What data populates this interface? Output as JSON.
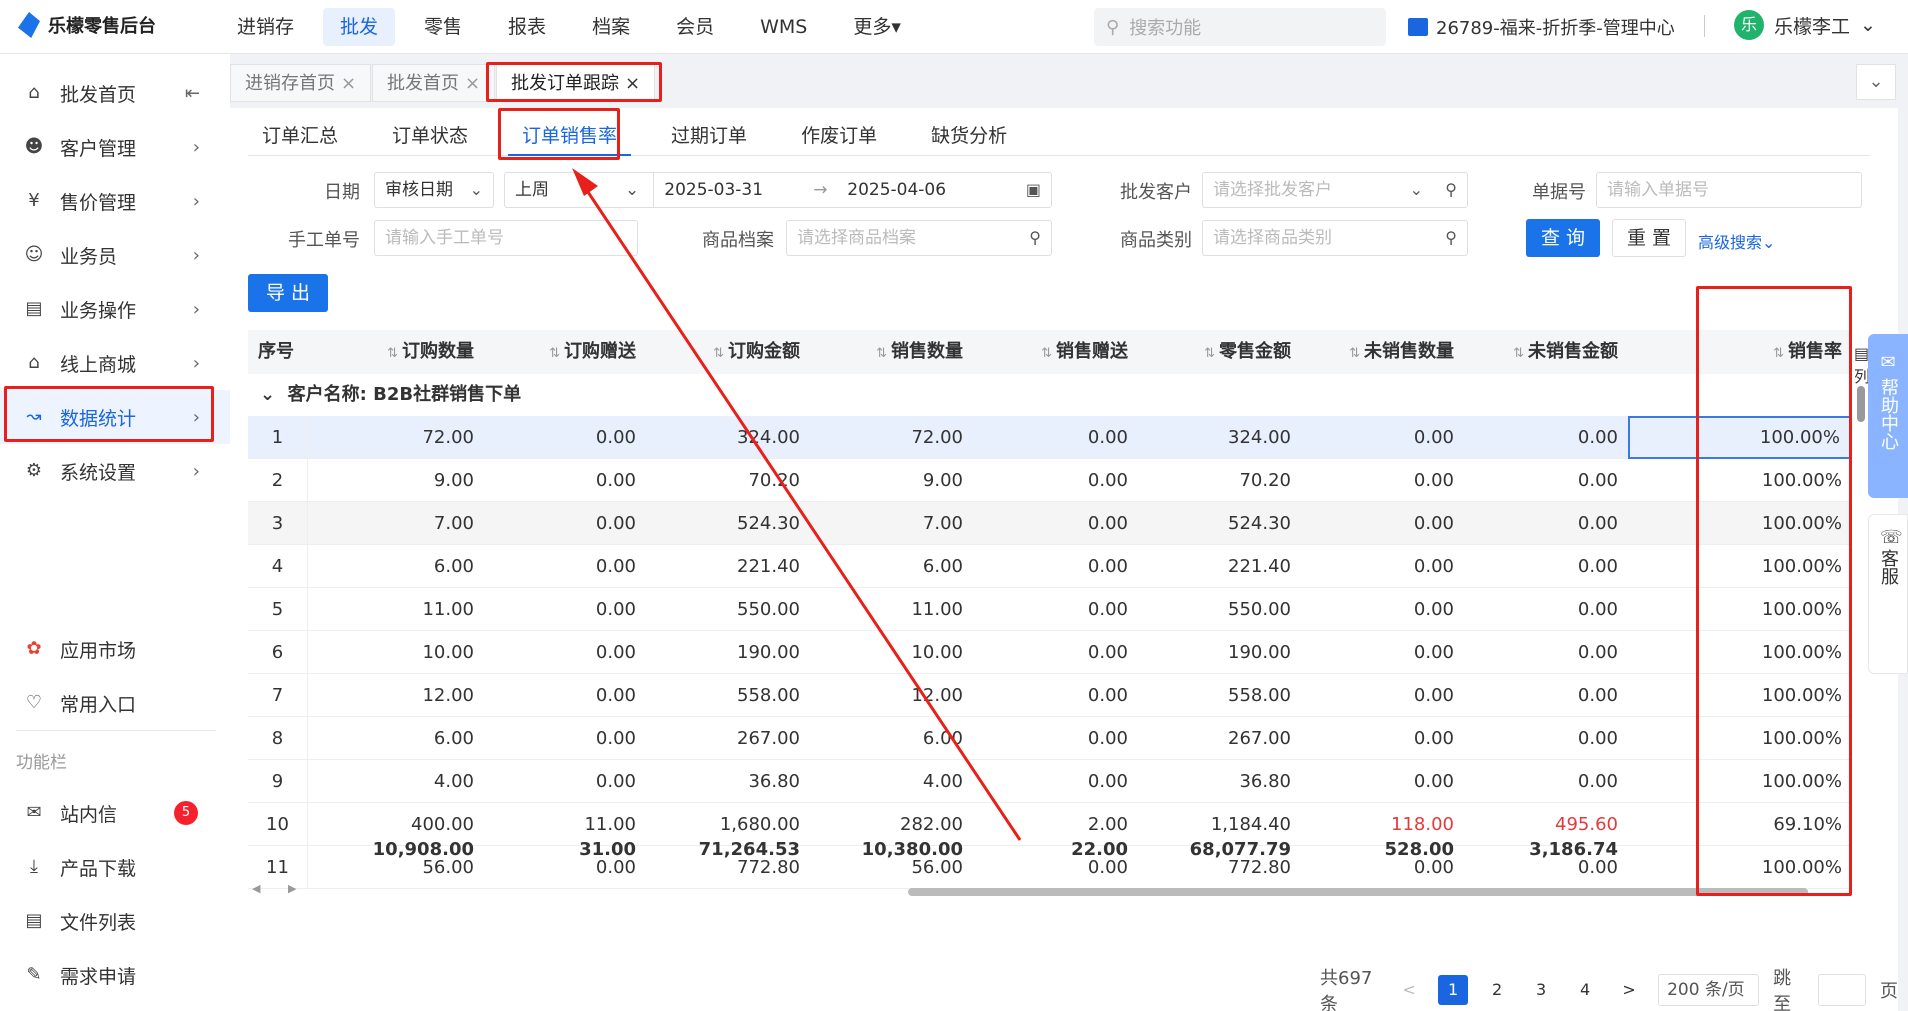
{
  "header": {
    "logo_text": "乐檬零售后台",
    "nav": [
      "进销存",
      "批发",
      "零售",
      "报表",
      "档案",
      "会员",
      "WMS",
      "更多▾"
    ],
    "active_nav": "批发",
    "search_placeholder": "搜索功能",
    "store": "26789-福来-折折季-管理中心",
    "avatar_char": "乐",
    "user_name": "乐檬李工"
  },
  "sidebar": {
    "items": [
      {
        "label": "批发首页",
        "icon": "home-icon",
        "chev": "⇤"
      },
      {
        "label": "客户管理",
        "icon": "user-icon",
        "chev": "›"
      },
      {
        "label": "售价管理",
        "icon": "yen-icon",
        "chev": "›"
      },
      {
        "label": "业务员",
        "icon": "person-icon",
        "chev": "›"
      },
      {
        "label": "业务操作",
        "icon": "panel-icon",
        "chev": "›"
      },
      {
        "label": "线上商城",
        "icon": "shop-icon",
        "chev": "›"
      },
      {
        "label": "数据统计",
        "icon": "chart-icon",
        "chev": "›"
      },
      {
        "label": "系统设置",
        "icon": "gear-icon",
        "chev": "›"
      }
    ],
    "bottom": [
      {
        "label": "应用市场",
        "icon": "app-market-icon"
      },
      {
        "label": "常用入口",
        "icon": "heart-icon"
      }
    ],
    "section_title": "功能栏",
    "tools": [
      {
        "label": "站内信",
        "icon": "mail-icon"
      },
      {
        "label": "产品下载",
        "icon": "download-icon"
      },
      {
        "label": "文件列表",
        "icon": "file-list-icon"
      },
      {
        "label": "需求申请",
        "icon": "request-icon"
      }
    ],
    "mail_badge": "5"
  },
  "page_tabs": [
    {
      "label": "进销存首页",
      "close": "×"
    },
    {
      "label": "批发首页",
      "close": "×"
    },
    {
      "label": "批发订单跟踪",
      "close": "×"
    }
  ],
  "sub_tabs": [
    "订单汇总",
    "订单状态",
    "订单销售率",
    "过期订单",
    "作废订单",
    "缺货分析"
  ],
  "filters": {
    "date_label": "日期",
    "date_type": "审核日期",
    "date_range": "上周",
    "date_start": "2025-03-31",
    "date_sep": "→",
    "date_end": "2025-04-06",
    "customer_label": "批发客户",
    "customer_placeholder": "请选择批发客户",
    "doc_label": "单据号",
    "doc_placeholder": "请输入单据号",
    "manual_label": "手工单号",
    "manual_placeholder": "请输入手工单号",
    "product_label": "商品档案",
    "product_placeholder": "请选择商品档案",
    "category_label": "商品类别",
    "category_placeholder": "请选择商品类别",
    "query_btn": "查 询",
    "reset_btn": "重 置",
    "advanced": "高级搜索",
    "export_btn": "导 出"
  },
  "table": {
    "columns": [
      "序号",
      "订购数量",
      "订购赠送",
      "订购金额",
      "销售数量",
      "销售赠送",
      "零售金额",
      "未销售数量",
      "未销售金额",
      "销售率"
    ],
    "group_label": "客户名称:  B2B社群销售下单",
    "rows": [
      [
        "1",
        "72.00",
        "0.00",
        "324.00",
        "72.00",
        "0.00",
        "324.00",
        "0.00",
        "0.00",
        "100.00%"
      ],
      [
        "2",
        "9.00",
        "0.00",
        "70.20",
        "9.00",
        "0.00",
        "70.20",
        "0.00",
        "0.00",
        "100.00%"
      ],
      [
        "3",
        "7.00",
        "0.00",
        "524.30",
        "7.00",
        "0.00",
        "524.30",
        "0.00",
        "0.00",
        "100.00%"
      ],
      [
        "4",
        "6.00",
        "0.00",
        "221.40",
        "6.00",
        "0.00",
        "221.40",
        "0.00",
        "0.00",
        "100.00%"
      ],
      [
        "5",
        "11.00",
        "0.00",
        "550.00",
        "11.00",
        "0.00",
        "550.00",
        "0.00",
        "0.00",
        "100.00%"
      ],
      [
        "6",
        "10.00",
        "0.00",
        "190.00",
        "10.00",
        "0.00",
        "190.00",
        "0.00",
        "0.00",
        "100.00%"
      ],
      [
        "7",
        "12.00",
        "0.00",
        "558.00",
        "12.00",
        "0.00",
        "558.00",
        "0.00",
        "0.00",
        "100.00%"
      ],
      [
        "8",
        "6.00",
        "0.00",
        "267.00",
        "6.00",
        "0.00",
        "267.00",
        "0.00",
        "0.00",
        "100.00%"
      ],
      [
        "9",
        "4.00",
        "0.00",
        "36.80",
        "4.00",
        "0.00",
        "36.80",
        "0.00",
        "0.00",
        "100.00%"
      ],
      [
        "10",
        "400.00",
        "11.00",
        "1,680.00",
        "282.00",
        "2.00",
        "1,184.40",
        "118.00",
        "495.60",
        "69.10%"
      ],
      [
        "11",
        "56.00",
        "0.00",
        "772.80",
        "56.00",
        "0.00",
        "772.80",
        "0.00",
        "0.00",
        "100.00%"
      ]
    ],
    "totals": [
      "",
      "10,908.00",
      "31.00",
      "71,264.53",
      "10,380.00",
      "22.00",
      "68,077.79",
      "528.00",
      "3,186.74",
      ""
    ]
  },
  "pagination": {
    "total": "共697条",
    "prev": "<",
    "pages": [
      "1",
      "2",
      "3",
      "4"
    ],
    "next": ">",
    "page_size": "200 条/页",
    "jump_label": "跳至",
    "page_unit": "页"
  },
  "floating": {
    "help": "帮助中心",
    "service": "客服",
    "column_setting": "列"
  },
  "colors": {
    "accent": "#1a66e0",
    "annotation": "#e8201c",
    "negative": "#e23b3b"
  }
}
